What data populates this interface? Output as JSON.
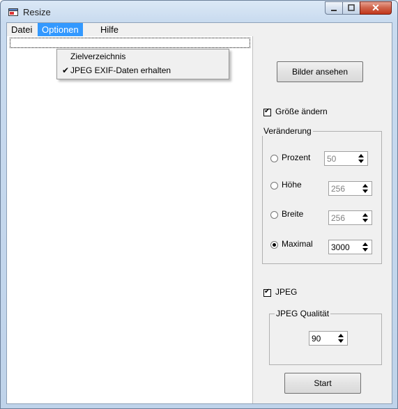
{
  "window": {
    "title": "Resize",
    "controls": [
      "minimize",
      "maximize",
      "close"
    ]
  },
  "menubar": {
    "items": [
      "Datei",
      "Optionen",
      "Hilfe"
    ],
    "active": "Optionen"
  },
  "dropdown": {
    "items": [
      {
        "label": "Zielverzeichnis",
        "checked": false
      },
      {
        "label": "JPEG EXIF-Daten erhalten",
        "checked": true
      }
    ]
  },
  "sidebar": {
    "view_button": "Bilder ansehen",
    "resize_checkbox": {
      "label": "Größe ändern",
      "checked": true
    },
    "change_group": {
      "title": "Veränderung",
      "options": [
        {
          "label": "Prozent",
          "value": "50",
          "selected": false
        },
        {
          "label": "Höhe",
          "value": "256",
          "selected": false
        },
        {
          "label": "Breite",
          "value": "256",
          "selected": false
        },
        {
          "label": "Maximal",
          "value": "3000",
          "selected": true
        }
      ]
    },
    "jpeg_checkbox": {
      "label": "JPEG",
      "checked": true
    },
    "quality_group": {
      "title": "JPEG Qualität",
      "value": "90"
    },
    "start_button": "Start"
  },
  "icons": {
    "app": "window-resize-icon",
    "check": "checkmark-icon"
  },
  "colors": {
    "menu_highlight": "#3399ff",
    "close_button": "#c2371b",
    "face": "#f0f0f0"
  }
}
